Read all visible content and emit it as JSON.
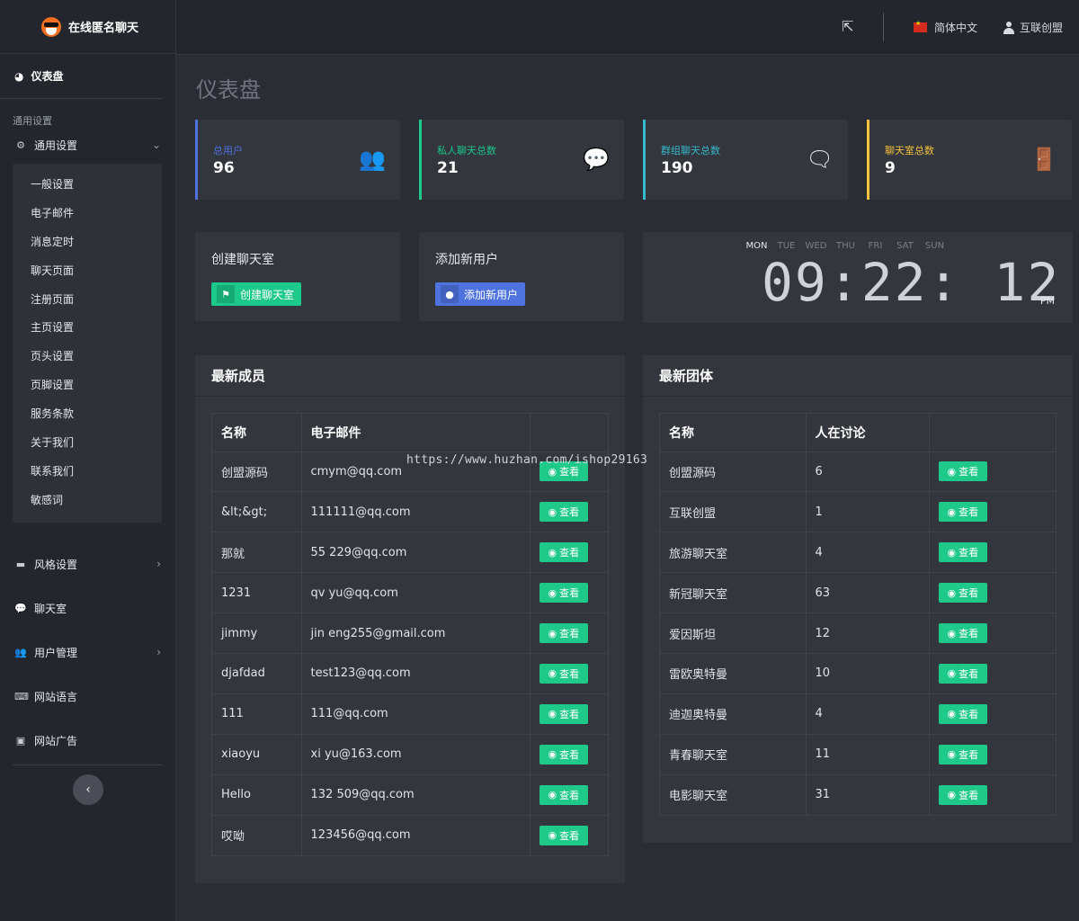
{
  "brand": {
    "name": "在线匿名聊天"
  },
  "topbar": {
    "language": "简体中文",
    "user": "互联创盟"
  },
  "sidebar": {
    "dashboard": "仪表盘",
    "section_label": "通用设置",
    "general": "通用设置",
    "sub_items": [
      "一般设置",
      "电子邮件",
      "消息定时",
      "聊天页面",
      "注册页面",
      "主页设置",
      "页头设置",
      "页脚设置",
      "服务条款",
      "关于我们",
      "联系我们",
      "敏感词"
    ],
    "groups": [
      {
        "label": "风格设置",
        "icon": "card-icon",
        "chevron": true
      },
      {
        "label": "聊天室",
        "icon": "comments-icon",
        "chevron": false
      },
      {
        "label": "用户管理",
        "icon": "users-icon",
        "chevron": true
      },
      {
        "label": "网站语言",
        "icon": "keyboard-icon",
        "chevron": false
      },
      {
        "label": "网站广告",
        "icon": "image-icon",
        "chevron": false
      }
    ]
  },
  "page": {
    "title": "仪表盘"
  },
  "stats": [
    {
      "label": "总用户",
      "value": "96",
      "color": "#4e73df",
      "icon": "users-icon"
    },
    {
      "label": "私人聊天总数",
      "value": "21",
      "color": "#1cc88a",
      "icon": "comment-icon"
    },
    {
      "label": "群组聊天总数",
      "value": "190",
      "color": "#36b9cc",
      "icon": "comments-icon"
    },
    {
      "label": "聊天室总数",
      "value": "9",
      "color": "#f6c23e",
      "icon": "door-icon"
    }
  ],
  "actions": {
    "create_room": {
      "title": "创建聊天室",
      "button": "创建聊天室",
      "color": "#1cc88a"
    },
    "add_user": {
      "title": "添加新用户",
      "button": "添加新用户",
      "color": "#4e73df"
    }
  },
  "clock": {
    "days": [
      "MON",
      "TUE",
      "WED",
      "THU",
      "FRI",
      "SAT",
      "SUN"
    ],
    "active_day": "MON",
    "time": "09:22: 12",
    "ampm": "PM"
  },
  "members": {
    "title": "最新成员",
    "columns": [
      "名称",
      "电子邮件",
      ""
    ],
    "button": "查看",
    "rows": [
      [
        "创盟源码",
        "cmym@qq.com"
      ],
      [
        "&lt;&gt;",
        "111111@qq.com"
      ],
      [
        "那就",
        "55       229@qq.com"
      ],
      [
        "1231",
        "qv     yu@qq.com"
      ],
      [
        "jimmy",
        "jin        eng255@gmail.com"
      ],
      [
        "djafdad",
        "test123@qq.com"
      ],
      [
        "111",
        "111@qq.com"
      ],
      [
        "xiaoyu",
        "xi   yu@163.com"
      ],
      [
        "Hello",
        "132       509@qq.com"
      ],
      [
        "哎呦",
        "123456@qq.com"
      ]
    ]
  },
  "groups_table": {
    "title": "最新团体",
    "columns": [
      "名称",
      "人在讨论",
      ""
    ],
    "button": "查看",
    "rows": [
      [
        "创盟源码",
        "6"
      ],
      [
        "互联创盟",
        "1"
      ],
      [
        "旅游聊天室",
        "4"
      ],
      [
        "新冠聊天室",
        "63"
      ],
      [
        "爱因斯坦",
        "12"
      ],
      [
        "雷欧奥特曼",
        "10"
      ],
      [
        "迪迦奥特曼",
        "4"
      ],
      [
        "青春聊天室",
        "11"
      ],
      [
        "电影聊天室",
        "31"
      ]
    ]
  },
  "watermark": "https://www.huzhan.com/ishop29163"
}
